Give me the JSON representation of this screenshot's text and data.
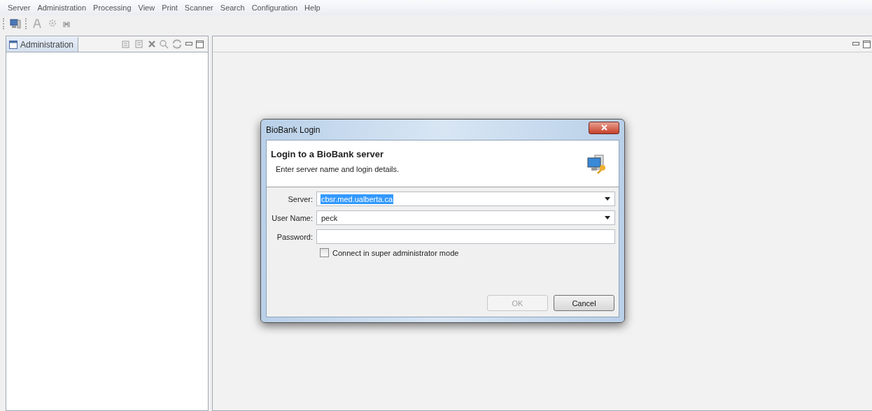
{
  "menu": [
    "Server",
    "Administration",
    "Processing",
    "View",
    "Print",
    "Scanner",
    "Search",
    "Configuration",
    "Help"
  ],
  "left_view": {
    "tab": {
      "label": "Administration",
      "selected": true
    }
  },
  "dialog": {
    "title": "BioBank Login",
    "heading": "Login to a BioBank server",
    "subtitle": "Enter server name and login details.",
    "fields": [
      {
        "label": "Server:",
        "value": "cbsr.med.ualberta.ca",
        "kind": "combo",
        "text_selected": true
      },
      {
        "label": "User Name:",
        "value": "peck",
        "kind": "combo",
        "text_selected": false
      },
      {
        "label": "Password:",
        "kind": "password"
      }
    ],
    "checkbox": {
      "label": "Connect in super administrator mode",
      "checked": false
    },
    "buttons": [
      {
        "label": "OK",
        "disabled": true
      },
      {
        "label": "Cancel",
        "disabled": false
      }
    ]
  }
}
